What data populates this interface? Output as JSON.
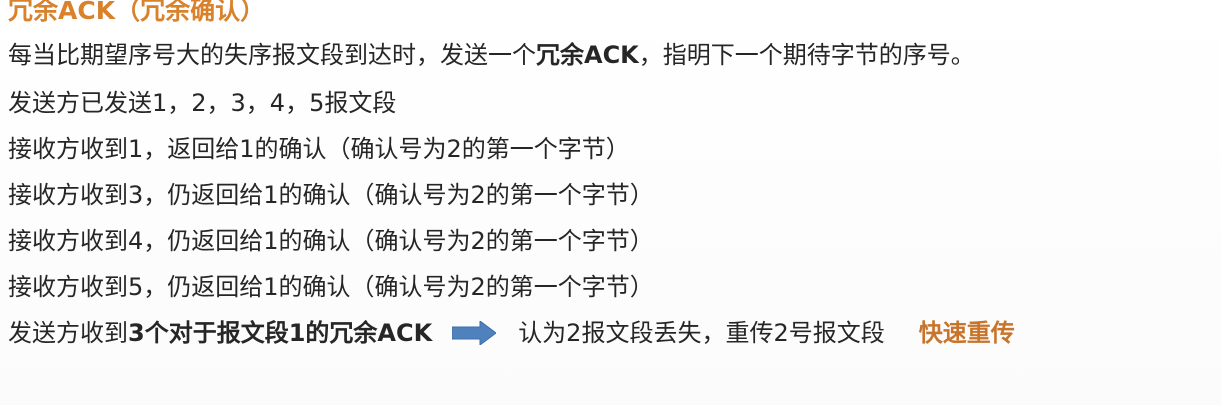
{
  "heading": "冗余ACK（冗余确认）",
  "lines": {
    "l1_pre": "每当比期望序号大的失序报文段到达时，发送一个",
    "l1_bold": "冗余ACK",
    "l1_post": "，指明下一个期待字节的序号。",
    "l2": "发送方已发送1，2，3，4，5报文段",
    "l3": "接收方收到1，返回给1的确认（确认号为2的第一个字节）",
    "l4": "接收方收到3，仍返回给1的确认（确认号为2的第一个字节）",
    "l5": "接收方收到4，仍返回给1的确认（确认号为2的第一个字节）",
    "l6": "接收方收到5，仍返回给1的确认（确认号为2的第一个字节）",
    "l7_pre": "发送方收到",
    "l7_bold": "3个对于报文段1的冗余ACK",
    "l7_result": "认为2报文段丢失，重传2号报文段",
    "l7_accent": "快速重传"
  },
  "colors": {
    "heading": "#d9822b",
    "accent": "#c8742b",
    "arrow": "#4f81bd",
    "text": "#262626"
  },
  "icons": {
    "arrow": "right-arrow-icon"
  }
}
